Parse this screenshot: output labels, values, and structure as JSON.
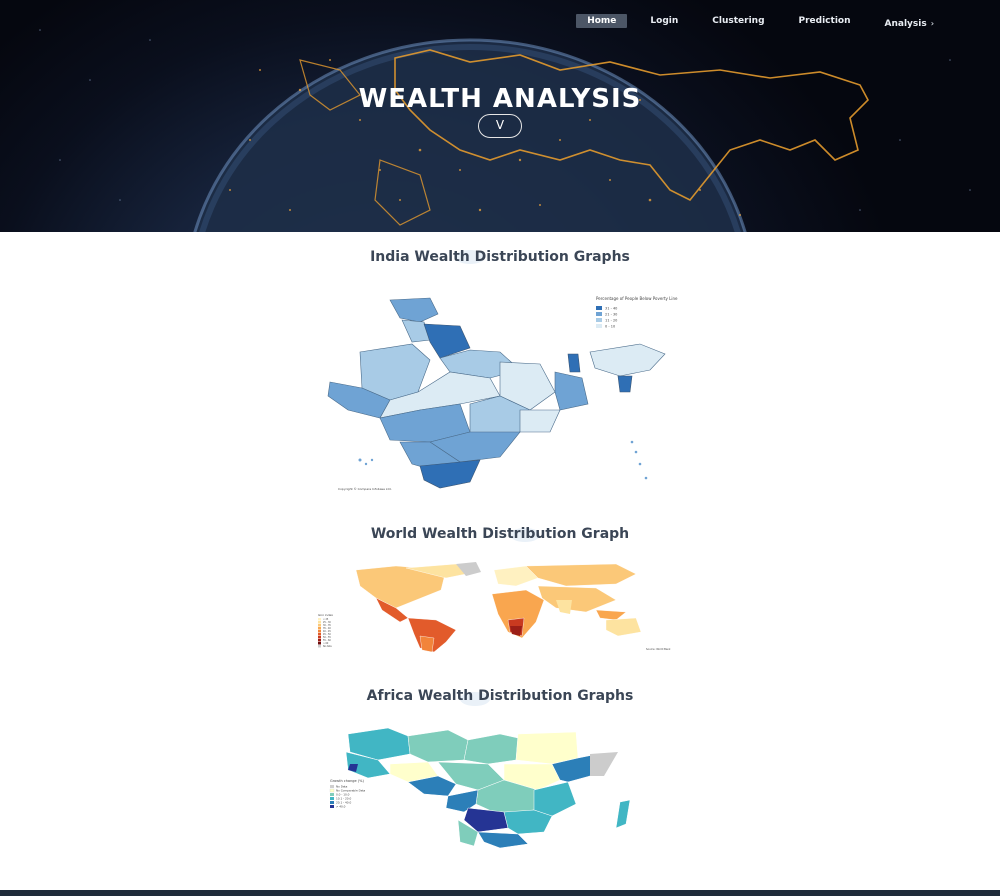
{
  "nav": {
    "items": [
      {
        "label": "Home",
        "active": true
      },
      {
        "label": "Login",
        "active": false
      },
      {
        "label": "Clustering",
        "active": false
      },
      {
        "label": "Prediction",
        "active": false
      },
      {
        "label": "Analysis",
        "active": false,
        "chevron": "›"
      }
    ]
  },
  "hero": {
    "title": "WEALTH ANALYSIS",
    "button_glyph": "V"
  },
  "sections": {
    "india": {
      "title": "India Wealth Distribution Graphs",
      "legend_title": "Percentage of People Below Poverty Line",
      "legend_entries": [
        "31 - 40",
        "21 - 30",
        "11 - 20",
        "0 - 10"
      ],
      "legend_colors": [
        "#2f6fb5",
        "#6fa3d4",
        "#a8cbe6",
        "#dcebf4"
      ],
      "credit": "Copyright © Compare Infobase Ltd."
    },
    "world": {
      "title": "World Wealth Distribution Graph",
      "legend_title": "Gini index",
      "legend_entries": [
        "< 25",
        "25 - 30",
        "30 - 35",
        "35 - 40",
        "40 - 45",
        "45 - 50",
        "50 - 55",
        "55 - 60",
        "> 60",
        "No data"
      ],
      "legend_colors": [
        "#fff1c1",
        "#fde3a0",
        "#fbc878",
        "#f9a64f",
        "#f2843a",
        "#e25b2b",
        "#c93a20",
        "#9c1f17",
        "#6e0f10",
        "#cccccc"
      ],
      "credit": "Source: World Bank"
    },
    "africa": {
      "title": "Africa Wealth Distribution Graphs",
      "legend_title": "Growth change (%)",
      "legend_entries": [
        "No Data",
        "No Comparable Data",
        "0.0 - 10.0",
        "10.1 - 20.0",
        "20.1 - 40.0",
        "> 40.0"
      ],
      "legend_colors": [
        "#d0d0d0",
        "#ffffcc",
        "#7fcdbb",
        "#41b6c4",
        "#2c7fb8",
        "#253494"
      ]
    }
  },
  "colors": {
    "hero_dark": "#0a0f1d",
    "heading": "#3b4656",
    "accent_orange": "#f0a030"
  }
}
